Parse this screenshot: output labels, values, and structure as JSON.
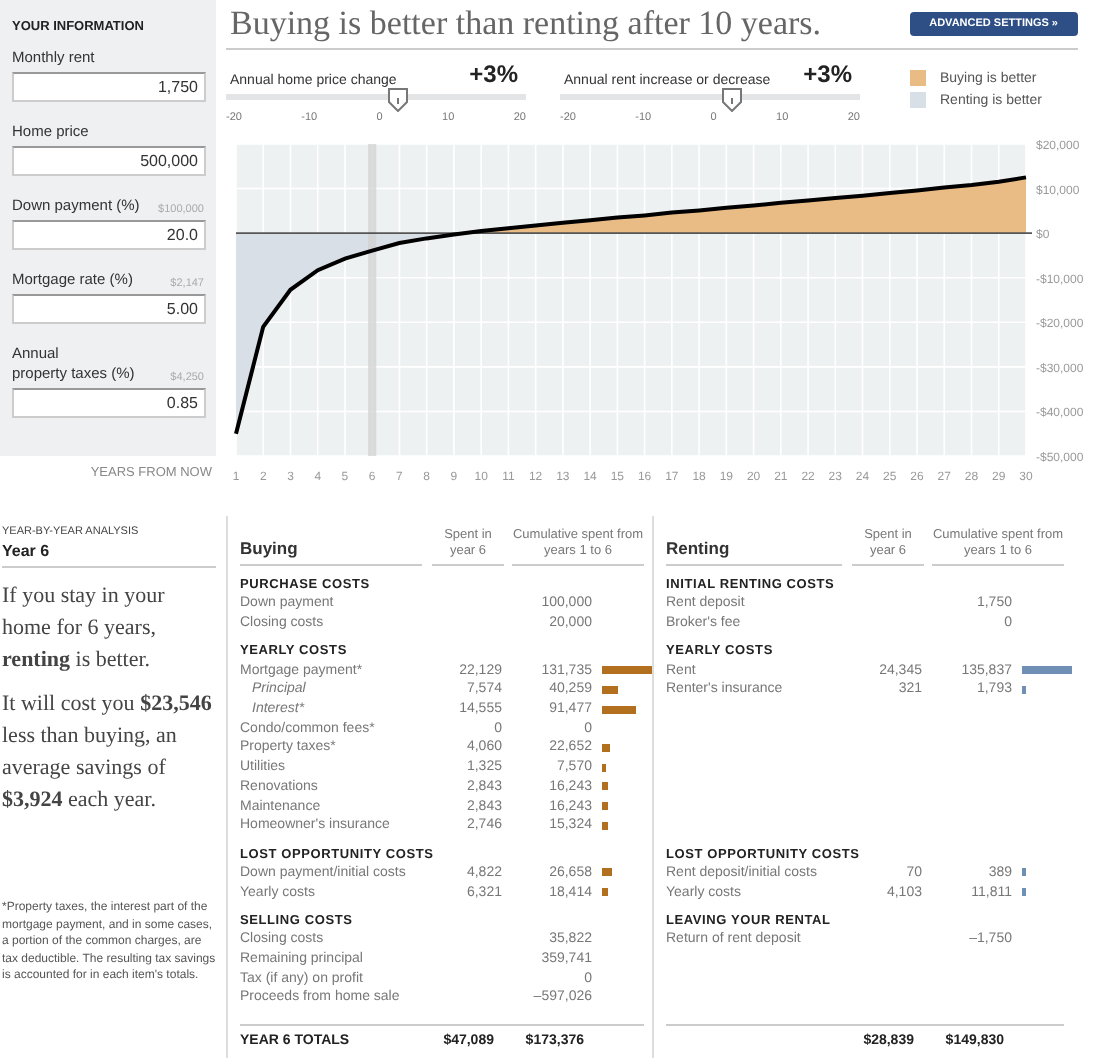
{
  "info": {
    "title": "YOUR INFORMATION",
    "fields": [
      {
        "label": "Monthly rent",
        "value": "1,750"
      },
      {
        "label": "Home price",
        "value": "500,000"
      },
      {
        "label": "Down payment (%)",
        "hint": "$100,000",
        "value": "20.0"
      },
      {
        "label": "Mortgage rate (%)",
        "hint": "$2,147",
        "value": "5.00"
      },
      {
        "label": "Annual\nproperty taxes (%)",
        "hint": "$4,250",
        "value": "0.85"
      }
    ]
  },
  "headline": "Buying is better than renting after 10 years.",
  "advanced_button": "ADVANCED SETTINGS »",
  "sliders": [
    {
      "label": "Annual home price change",
      "reading": "+3%",
      "level": 0.575,
      "ticks": [
        "-20",
        "-10",
        "0",
        "10",
        "20"
      ]
    },
    {
      "label": "Annual rent increase or decrease",
      "reading": "+3%",
      "level": 0.575,
      "ticks": [
        "-20",
        "-10",
        "0",
        "10",
        "20"
      ]
    }
  ],
  "legend": [
    {
      "label": "Buying is better",
      "color": "#e9bb85"
    },
    {
      "label": "Renting is better",
      "color": "#d9dfe7"
    }
  ],
  "chart": {
    "chart_data": {
      "type": "area",
      "xlabel": "YEARS FROM NOW",
      "x": [
        1,
        2,
        3,
        4,
        5,
        6,
        7,
        8,
        9,
        10,
        11,
        12,
        13,
        14,
        15,
        16,
        17,
        18,
        19,
        20,
        21,
        22,
        23,
        24,
        25,
        26,
        27,
        28,
        29,
        30
      ],
      "series": [
        {
          "color": "#000000",
          "values": [
            -45000,
            -21000,
            -12700,
            -8300,
            -5700,
            -3900,
            -2200,
            -1200,
            -300,
            500,
            1100,
            1700,
            2300,
            2900,
            3500,
            4000,
            4600,
            5100,
            5700,
            6200,
            6800,
            7300,
            7900,
            8400,
            9000,
            9600,
            10200,
            10800,
            11500,
            12500
          ]
        }
      ],
      "xlim": [
        1,
        30
      ],
      "ylim": [
        -50000,
        20000
      ],
      "xticks": [
        1,
        2,
        3,
        4,
        5,
        6,
        7,
        8,
        9,
        10,
        11,
        12,
        13,
        14,
        15,
        16,
        17,
        18,
        19,
        20,
        21,
        22,
        23,
        24,
        25,
        26,
        27,
        28,
        29,
        30
      ],
      "yticks": [
        {
          "value": 20000,
          "label": "$20,000"
        },
        {
          "value": 10000,
          "label": "$10,000"
        },
        {
          "value": 0,
          "label": "$0"
        },
        {
          "value": -10000,
          "label": "-$10,000"
        },
        {
          "value": -20000,
          "label": "-$20,000"
        },
        {
          "value": -30000,
          "label": "-$30,000"
        },
        {
          "value": -40000,
          "label": "-$40,000"
        },
        {
          "value": -50000,
          "label": "-$50,000"
        }
      ],
      "grid": true,
      "bands": [
        {
          "axis": "x",
          "from": 5.85,
          "to": 6.15
        }
      ]
    }
  },
  "analysis": {
    "kicker": "YEAR-BY-YEAR ANALYSIS",
    "year": "Year 6",
    "paragraphs": [
      "If you stay in your home for 6 years, **renting** is better.",
      "It will cost you **$23,546** less than buying, an average savings of **$3,924** each year."
    ],
    "footnote": "*Property taxes, the interest part of the mortgage payment, and in some cases, a portion of the common charges, are tax deductible. The resulting tax savings is accounted for in each item's totals."
  },
  "buying": {
    "title": "Buying",
    "col_year": "Spent in year 6",
    "col_cum": "Cumulative spent from years 1 to 6",
    "sections": [
      {
        "title": "PURCHASE COSTS",
        "rows": [
          {
            "kind": "row",
            "label": "Down payment",
            "cumulative": "100,000"
          },
          {
            "kind": "row",
            "label": "Closing costs",
            "cumulative": "20,000"
          }
        ]
      },
      {
        "title": "YEARLY COSTS",
        "rows": [
          {
            "kind": "row",
            "label": "Mortgage payment*",
            "year": "22,129",
            "cumulative": "131,735"
          },
          {
            "kind": "sub",
            "label": "Principal",
            "year": "7,574",
            "cumulative": "40,259"
          },
          {
            "kind": "sub",
            "label": "Interest*",
            "year": "14,555",
            "cumulative": "91,477"
          },
          {
            "kind": "row",
            "label": "Condo/common fees*",
            "year": "0",
            "cumulative": "0"
          },
          {
            "kind": "row",
            "label": "Property taxes*",
            "year": "4,060",
            "cumulative": "22,652"
          },
          {
            "kind": "row",
            "label": "Utilities",
            "year": "1,325",
            "cumulative": "7,570"
          },
          {
            "kind": "row",
            "label": "Renovations",
            "year": "2,843",
            "cumulative": "16,243"
          },
          {
            "kind": "row",
            "label": "Maintenance",
            "year": "2,843",
            "cumulative": "16,243"
          },
          {
            "kind": "row",
            "label": "Homeowner's insurance",
            "year": "2,746",
            "cumulative": "15,324"
          }
        ]
      },
      {
        "title": "LOST OPPORTUNITY COSTS",
        "rows": [
          {
            "kind": "row",
            "label": "Down payment/initial costs",
            "year": "4,822",
            "cumulative": "26,658"
          },
          {
            "kind": "row",
            "label": "Yearly costs",
            "year": "6,321",
            "cumulative": "18,414"
          }
        ]
      },
      {
        "title": "SELLING COSTS",
        "rows": [
          {
            "kind": "row",
            "label": "Closing costs",
            "cumulative": "35,822"
          },
          {
            "kind": "row",
            "label": "Remaining principal",
            "cumulative": "359,741"
          },
          {
            "kind": "row",
            "label": "Tax (if any) on profit",
            "cumulative": "0"
          },
          {
            "kind": "row",
            "label": "Proceeds from home sale",
            "cumulative": "–597,026"
          }
        ]
      }
    ],
    "totals": {
      "label": "YEAR 6 TOTALS",
      "year": "$47,089",
      "cumulative": "$173,376"
    }
  },
  "renting": {
    "title": "Renting",
    "col_year": "Spent in year 6",
    "col_cum": "Cumulative spent from years 1 to 6",
    "sections": [
      {
        "title": "INITIAL RENTING COSTS",
        "rows": [
          {
            "kind": "row",
            "label": "Rent deposit",
            "cumulative": "1,750"
          },
          {
            "kind": "row",
            "label": "Broker's fee",
            "cumulative": "0"
          }
        ]
      },
      {
        "title": "YEARLY COSTS",
        "rows": [
          {
            "kind": "row",
            "label": "Rent",
            "year": "24,345",
            "cumulative": "135,837"
          },
          {
            "kind": "row",
            "label": "Renter's insurance",
            "year": "321",
            "cumulative": "1,793"
          }
        ]
      },
      {
        "title": "LOST OPPORTUNITY COSTS",
        "rows": [
          {
            "kind": "row",
            "label": "Rent deposit/initial costs",
            "year": "70",
            "cumulative": "389"
          },
          {
            "kind": "row",
            "label": "Yearly costs",
            "year": "4,103",
            "cumulative": "11,811"
          }
        ]
      },
      {
        "title": "LEAVING YOUR RENTAL",
        "rows": [
          {
            "kind": "row",
            "label": "Return of rent deposit",
            "cumulative": "–1,750"
          }
        ]
      }
    ],
    "totals": {
      "year": "$28,839",
      "cumulative": "$149,830"
    }
  }
}
